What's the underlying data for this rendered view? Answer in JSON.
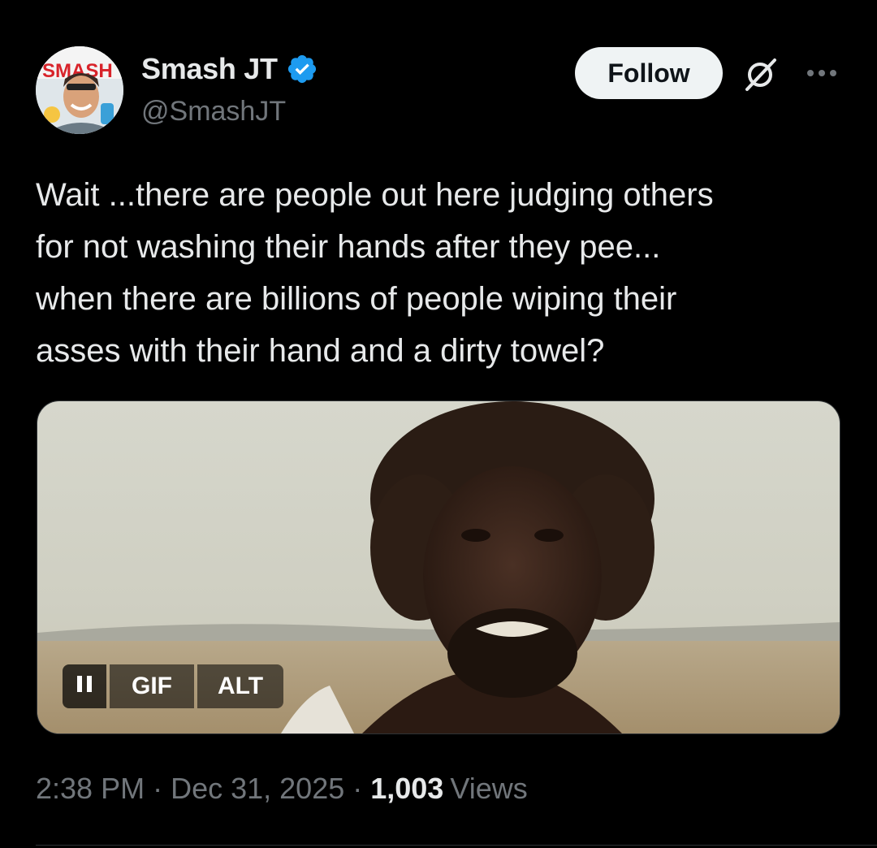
{
  "author": {
    "avatar_text": "SMASH",
    "name": "Smash JT",
    "handle": "@SmashJT",
    "verified": true
  },
  "actions": {
    "follow_label": "Follow",
    "grok_icon": "grok-icon",
    "more_icon": "more-icon"
  },
  "tweet": {
    "text": "Wait ...there are people out here judging others\nfor not washing their hands after they pee...\nwhen there are billions of people wiping their\nasses with their hand and a dirty towel?"
  },
  "media": {
    "type": "gif",
    "pause_icon": "pause-icon",
    "gif_label": "GIF",
    "alt_label": "ALT"
  },
  "meta": {
    "time": "2:38 PM",
    "separator": "·",
    "date": "Dec 31, 2025",
    "views_count": "1,003",
    "views_label": "Views"
  },
  "colors": {
    "background": "#000000",
    "text": "#e7e9ea",
    "secondary": "#71767b",
    "verified": "#1d9bf0",
    "follow_bg": "#eff3f4"
  }
}
